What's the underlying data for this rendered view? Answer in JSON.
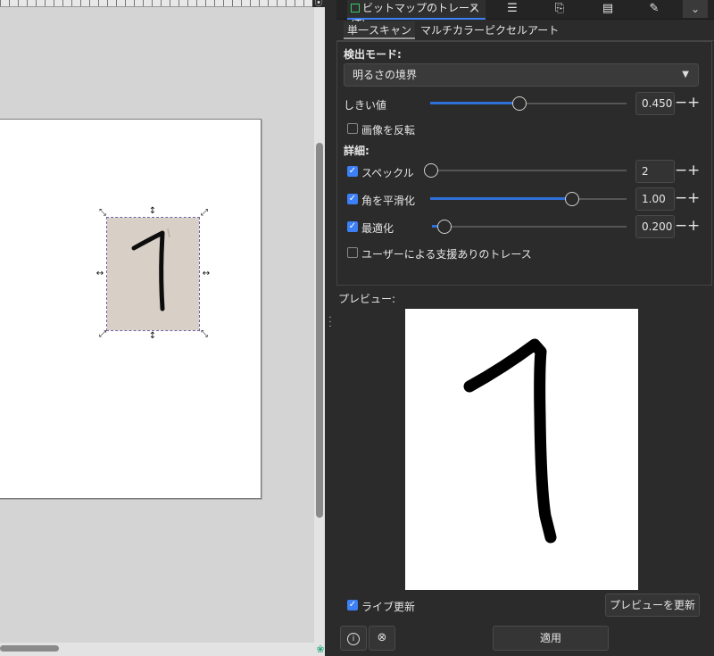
{
  "dock": {
    "active_tab_label": "ビットマップのトレース(T)",
    "close_glyph": "×",
    "menu_glyph": "⌄"
  },
  "mode_tabs": [
    {
      "label": "単一スキャン",
      "active": true
    },
    {
      "label": "マルチカラー",
      "active": false
    },
    {
      "label": "ピクセルアート",
      "active": false
    }
  ],
  "detection": {
    "heading": "検出モード:",
    "selected": "明るさの境界"
  },
  "threshold": {
    "label": "しきい値",
    "value": "0.450",
    "level": 0.45
  },
  "invert": {
    "label": "画像を反転",
    "checked": false
  },
  "details": {
    "heading": "詳細:",
    "speckles": {
      "label": "スペックル",
      "checked": true,
      "value": "2",
      "level": 0.0
    },
    "smooth": {
      "label": "角を平滑化",
      "checked": true,
      "value": "1.00",
      "level": 0.74
    },
    "optimize": {
      "label": "最適化",
      "checked": true,
      "value": "0.200",
      "level": 0.03
    },
    "assisted": {
      "label": "ユーザーによる支援ありのトレース",
      "checked": false
    }
  },
  "preview": {
    "label": "プレビュー:"
  },
  "live_update": {
    "label": "ライブ更新",
    "checked": true
  },
  "buttons": {
    "update_preview": "プレビューを更新",
    "apply": "適用",
    "info_glyph": "i",
    "reset_glyph": "⊗"
  },
  "colors": {
    "accent": "#3d7ff5",
    "panel_bg": "#2b2b2b",
    "canvas_bg": "#d4d4d4"
  }
}
